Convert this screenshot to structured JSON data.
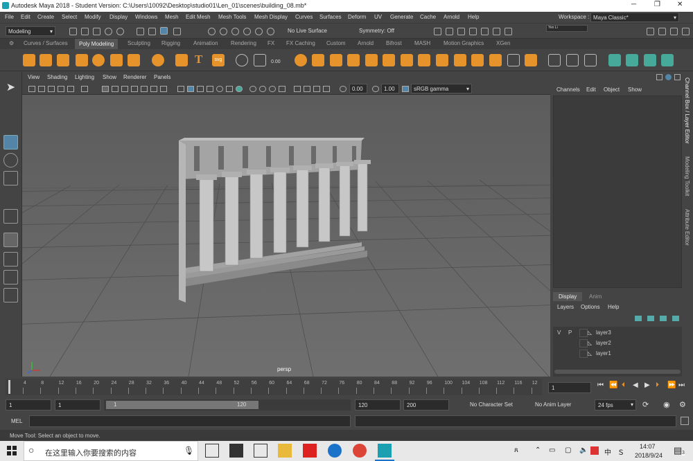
{
  "app": {
    "title": "Autodesk Maya 2018 - Student Version: C:\\Users\\10092\\Desktop\\studio01\\Len_01\\scenes\\building_08.mb*",
    "window_controls": [
      "─",
      "❐",
      "✕"
    ]
  },
  "menubar": {
    "items": [
      "File",
      "Edit",
      "Create",
      "Select",
      "Modify",
      "Display",
      "Windows",
      "Mesh",
      "Edit Mesh",
      "Mesh Tools",
      "Mesh Display",
      "Curves",
      "Surfaces",
      "Deform",
      "UV",
      "Generate",
      "Cache",
      "Arnold",
      "Help"
    ],
    "workspace_label": "Workspace :",
    "workspace_value": "Maya Classic*"
  },
  "statusline": {
    "mode": "Modeling",
    "live_surface": "No Live Surface",
    "symmetry": "Symmetry: Off",
    "user": "Yen Li"
  },
  "shelf": {
    "tabs": [
      "Curves / Surfaces",
      "Poly Modeling",
      "Sculpting",
      "Rigging",
      "Animation",
      "Rendering",
      "FX",
      "FX Caching",
      "Custom",
      "Arnold",
      "Bifrost",
      "MASH",
      "Motion Graphics",
      "XGen"
    ],
    "active_tab": "Poly Modeling",
    "text_icon": "T",
    "svg_icon": "svg",
    "value_icon": "0.00"
  },
  "viewport": {
    "menus": [
      "View",
      "Shading",
      "Lighting",
      "Show",
      "Renderer",
      "Panels"
    ],
    "near_value": "0.00",
    "far_value": "1.00",
    "colorspace": "sRGB gamma",
    "camera_label": "persp"
  },
  "channelbox": {
    "menus": [
      "Channels",
      "Edit",
      "Object",
      "Show"
    ]
  },
  "layer_editor": {
    "tabs": [
      "Display",
      "Anim"
    ],
    "menus": [
      "Layers",
      "Options",
      "Help"
    ],
    "layers": [
      {
        "v": "V",
        "p": "P",
        "name": "layer3"
      },
      {
        "v": "",
        "p": "",
        "name": "layer2"
      },
      {
        "v": "",
        "p": "",
        "name": "layer1"
      }
    ]
  },
  "side_tabs": [
    "Channel Box / Layer Editor",
    "Modeling Toolkit",
    "Attribute Editor"
  ],
  "timeline": {
    "ticks": [
      "4",
      "8",
      "12",
      "16",
      "20",
      "24",
      "28",
      "32",
      "36",
      "40",
      "44",
      "48",
      "52",
      "56",
      "60",
      "64",
      "68",
      "72",
      "76",
      "80",
      "84",
      "88",
      "92",
      "96",
      "100",
      "104",
      "108",
      "112",
      "116",
      "12"
    ],
    "current_frame": "1"
  },
  "range": {
    "start": "1",
    "playback_start": "1",
    "slider_start": "1",
    "slider_end": "120",
    "playback_end": "120",
    "end": "200",
    "character_set": "No Character Set",
    "anim_layer": "No Anim Layer",
    "fps": "24 fps"
  },
  "command": {
    "label": "MEL"
  },
  "helpline": {
    "text": "Move Tool: Select an object to move."
  },
  "taskbar": {
    "search_placeholder": "在这里输入你要搜索的内容",
    "time": "14:07",
    "date": "2018/9/24",
    "ime": "中",
    "badge": "3"
  }
}
